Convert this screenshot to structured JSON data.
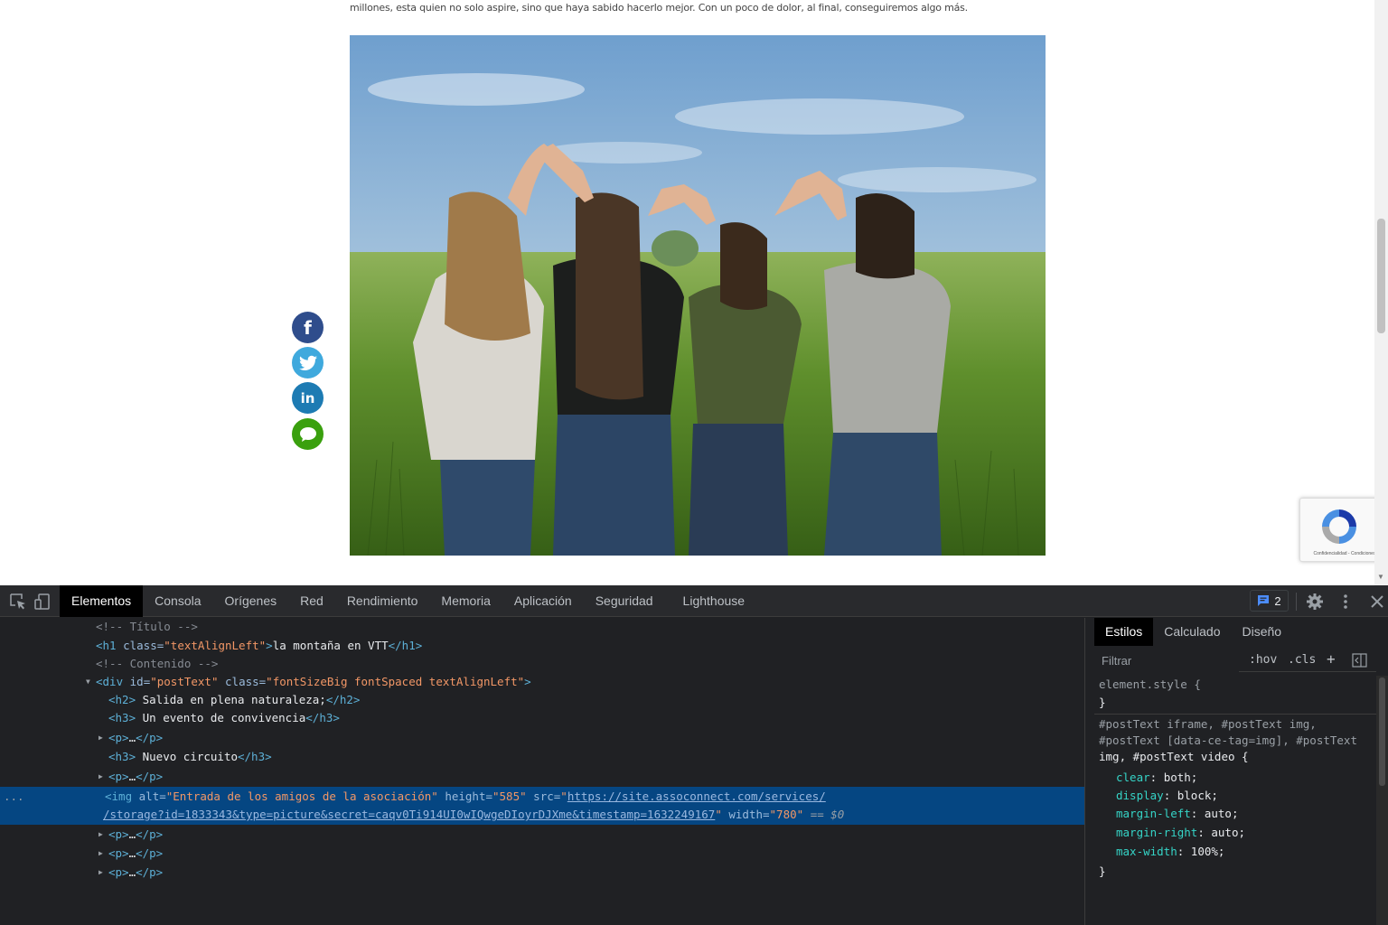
{
  "site": {
    "lead_text": "millones, esta quien no solo aspire, sino que haya sabido hacerlo mejor. Con un poco de dolor, al final, conseguiremos algo más.",
    "share_buttons": [
      {
        "name": "facebook",
        "glyph": "f",
        "color": "#2f4d8c"
      },
      {
        "name": "twitter",
        "icon": "twitter-bird-icon",
        "color": "#3fa9dd"
      },
      {
        "name": "linkedin",
        "glyph": "in",
        "color": "#1d7bb3"
      },
      {
        "name": "chat",
        "icon": "speech-bubble-icon",
        "color": "#3aa00e"
      }
    ],
    "recaptcha_terms": "Confidencialidad - Condiciones"
  },
  "devtools": {
    "tabs": [
      "Elementos",
      "Consola",
      "Orígenes",
      "Red",
      "Rendimiento",
      "Memoria",
      "Aplicación",
      "Seguridad",
      "Lighthouse"
    ],
    "active_tab": "Elementos",
    "issues_count": "2",
    "dom": {
      "comment_title": "<!-- Título -->",
      "h1_open": "<h1 ",
      "h1_attr": "class=",
      "h1_val": "\"textAlignLeft\"",
      "h1_text": "la montaña en VTT",
      "h1_close": "</h1>",
      "comment_content": "<!-- Contenido -->",
      "div_open": "<div ",
      "div_id_attr": "id=",
      "div_id_val": "\"postText\"",
      "div_class_attr": "class=",
      "div_class_val": "\"fontSizeBig fontSpaced textAlignLeft\"",
      "div_end": ">",
      "h2_open": "<h2>",
      "h2_text": " Salida en plena naturaleza;",
      "h2_close": "</h2>",
      "h3a_open": "<h3>",
      "h3a_text": " Un evento de convivencia",
      "h3a_close": "</h3>",
      "p_collapsed_open": "<p>",
      "p_ellipsis": "…",
      "p_collapsed_close": "</p>",
      "h3b_text": " Nuevo circuito",
      "img_open": "<img ",
      "img_alt_attr": "alt=",
      "img_alt_val": "\"Entrada de los amigos de la asociación\"",
      "img_height_attr": "height=",
      "img_height_val": "\"585\"",
      "img_src_attr": "src=",
      "img_src_quote": "\"",
      "img_src_link1": "https://site.assoconnect.com/services/",
      "img_src_link2": "/storage?id=1833343&type=picture&secret=caqv0Ti914UI0wIQwgeDIoyrDJXme&timestamp=1632249167",
      "img_width_attr": "width=",
      "img_width_val": "\"780\"",
      "img_eq": " == $0",
      "gutter_dots": "..."
    },
    "styles": {
      "tabs": [
        "Estilos",
        "Calculado",
        "Diseño"
      ],
      "active_tab": "Estilos",
      "filter_placeholder": "Filtrar",
      "hov": ":hov",
      "cls": ".cls",
      "plus": "+",
      "element_style": "element.style {",
      "close_brace": "}",
      "selector_lines": [
        "#postText iframe, #postText img,",
        "#postText [data-ce-tag=img], #postText",
        "img, #postText video {"
      ],
      "declarations": [
        {
          "prop": "clear",
          "value": "both;"
        },
        {
          "prop": "display",
          "value": "block;"
        },
        {
          "prop": "margin-left",
          "value": "auto;"
        },
        {
          "prop": "margin-right",
          "value": "auto;"
        },
        {
          "prop": "max-width",
          "value": "100%;"
        }
      ]
    }
  }
}
